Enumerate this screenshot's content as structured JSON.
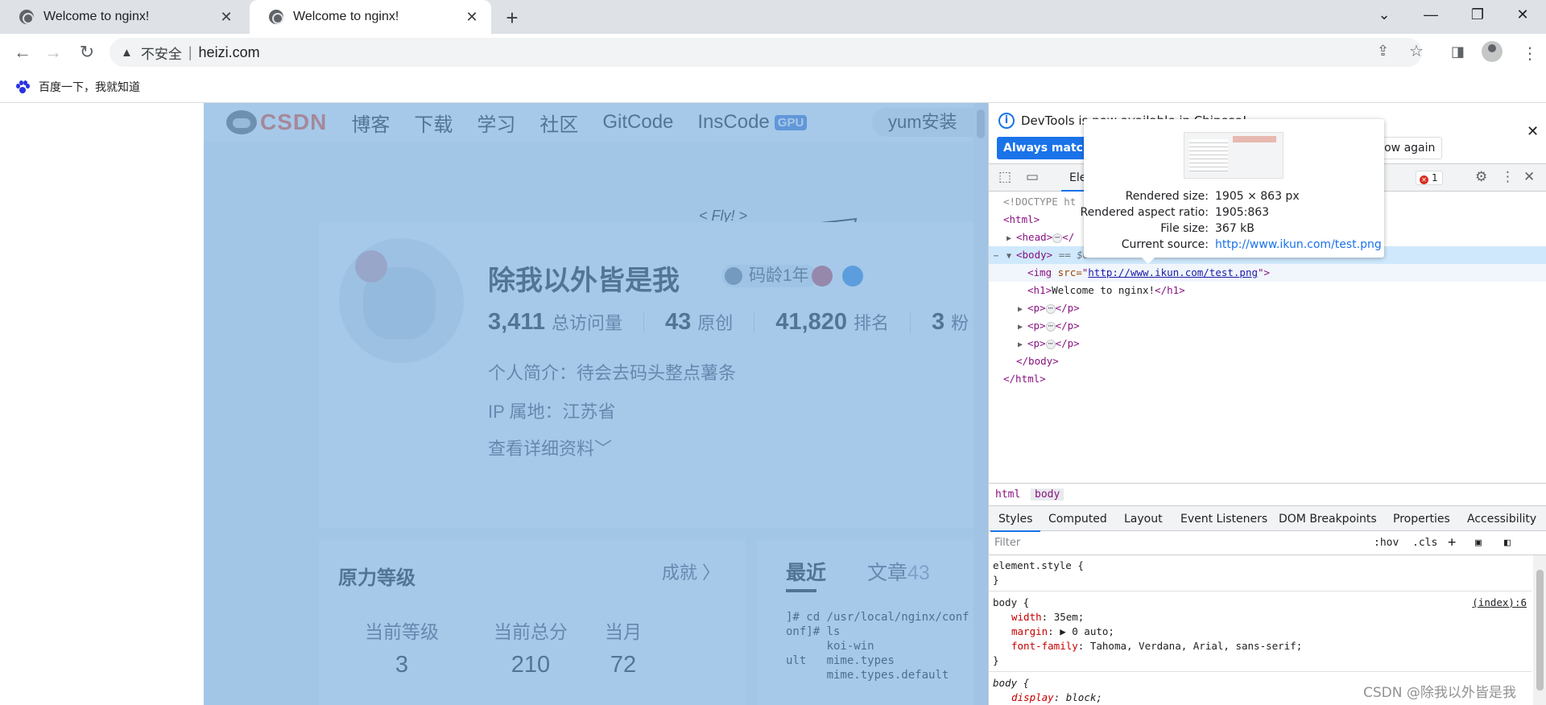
{
  "tabs": [
    {
      "title": "Welcome to nginx!",
      "close": "✕",
      "icon": "globe-icon"
    },
    {
      "title": "Welcome to nginx!",
      "close": "✕",
      "icon": "globe-icon"
    }
  ],
  "new_tab": "+",
  "window_controls": {
    "tab_search": "⌄",
    "minimize": "—",
    "restore": "❐",
    "close": "✕"
  },
  "toolbar": {
    "back": "←",
    "forward": "→",
    "reload": "↻",
    "security_icon": "▲",
    "security_label": "不安全",
    "separator": "|",
    "url": "heizi.com",
    "share_icon": "⇪",
    "star_icon": "☆",
    "sidebar_icon": "◨",
    "menu_icon": "⋮"
  },
  "bookmarks": [
    {
      "label": "百度一下，我就知道",
      "icon": "baidu-paw-icon"
    }
  ],
  "page": {
    "nav": {
      "logo": "CSDN",
      "items": [
        "博客",
        "下载",
        "学习",
        "社区",
        "GitCode",
        "InsCode"
      ],
      "gpu_badge": "GPU",
      "search_value": "yum安装"
    },
    "fly_text": "< Fly! >",
    "profile": {
      "name": "除我以外皆是我",
      "code_age": "码龄1年",
      "stats": [
        {
          "num": "3,411",
          "label": "总访问量"
        },
        {
          "num": "43",
          "label": "原创"
        },
        {
          "num": "41,820",
          "label": "排名"
        },
        {
          "num": "3",
          "label": "粉"
        }
      ],
      "bio": "个人简介：待会去码头整点薯条",
      "ip": "IP 属地：江苏省",
      "more": "查看详细资料﹀"
    },
    "level_panel": {
      "title": "原力等级",
      "link": "成就 〉",
      "cols": [
        {
          "title": "当前等级",
          "value": "3"
        },
        {
          "title": "当前总分",
          "value": "210"
        },
        {
          "title": "当月",
          "value": "72"
        }
      ]
    },
    "recent_panel": {
      "tabs": [
        "最近",
        "文章"
      ],
      "article_count": "43",
      "terminal_lines": [
        "]# cd /usr/local/nginx/conf",
        "onf]# ls",
        "      koi-win",
        "ult   mime.types",
        "      mime.types.default"
      ]
    }
  },
  "devtools": {
    "info_message": "DevTools is now available in Chinese!",
    "always_match": "Always match C",
    "dont_show": "t show again",
    "close": "✕",
    "panel_tab": "Ele",
    "error_count": "1",
    "dom": {
      "doctype": "<!DOCTYPE ht",
      "html_open": "<html>",
      "head_open": "<head>",
      "head_close": "</",
      "body_open": "<body>",
      "body_eq": "== $0",
      "img_open": "<img ",
      "img_attr": "src=",
      "img_src": "http://www.ikun.com/test.png",
      "img_close": ">",
      "h1_open": "<h1>",
      "h1_text": "Welcome to nginx!",
      "h1_close": "</h1>",
      "p_open": "<p>",
      "p_close": "</p>",
      "body_close": "</body>",
      "html_close": "</html>",
      "ellipsis": "⋯"
    },
    "tooltip": [
      {
        "key": "Rendered size:",
        "value": "1905 × 863 px"
      },
      {
        "key": "Rendered aspect ratio:",
        "value": "1905:863"
      },
      {
        "key": "File size:",
        "value": "367 kB"
      },
      {
        "key": "Current source:",
        "value": "http://www.ikun.com/test.png"
      }
    ],
    "breadcrumbs": [
      "html",
      "body"
    ],
    "styles_tabs": [
      "Styles",
      "Computed",
      "Layout",
      "Event Listeners",
      "DOM Breakpoints",
      "Properties",
      "Accessibility"
    ],
    "filter_placeholder": "Filter",
    "filter_tools": {
      "hov": ":hov",
      "cls": ".cls",
      "add": "+"
    },
    "rules": {
      "element_style": "element.style {",
      "close": "}",
      "body_selector": "body {",
      "body_source": "(index):6",
      "width_prop": "width",
      "width_val": ": 35em;",
      "margin_prop": "margin",
      "margin_val": ": ▶ 0 auto;",
      "font_prop": "font-family",
      "font_val": ": Tahoma, Verdana, Arial, sans-serif;",
      "ua_selector": "body {",
      "display_prop": "display",
      "display_val": ": block;"
    }
  },
  "watermark": "CSDN @除我以外皆是我",
  "colors": {
    "overlay": "#6fa8dc",
    "csdn_red": "#fc5531",
    "link_blue": "#1a73e8",
    "tag_purple": "#881280"
  }
}
